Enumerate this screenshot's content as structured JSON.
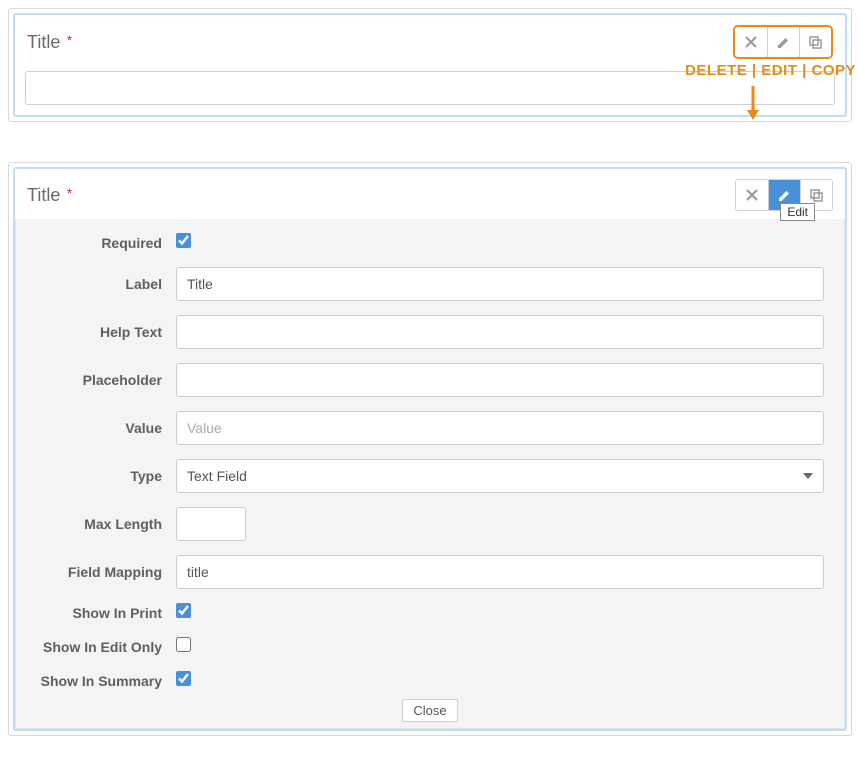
{
  "annotation": {
    "label": "DELETE | EDIT | COPY",
    "tooltip": "Edit"
  },
  "panel1": {
    "title": "Title",
    "required_mark": "*"
  },
  "panel2": {
    "title": "Title",
    "required_mark": "*"
  },
  "form": {
    "required_label": "Required",
    "required_checked": true,
    "label_label": "Label",
    "label_value": "Title",
    "helptext_label": "Help Text",
    "helptext_value": "",
    "placeholder_label": "Placeholder",
    "placeholder_value": "",
    "value_label": "Value",
    "value_placeholder": "Value",
    "type_label": "Type",
    "type_value": "Text Field",
    "maxlength_label": "Max Length",
    "maxlength_value": "",
    "fieldmapping_label": "Field Mapping",
    "fieldmapping_value": "title",
    "showinprint_label": "Show In Print",
    "showinprint_checked": true,
    "showineditonly_label": "Show In Edit Only",
    "showineditonly_checked": false,
    "showinsummary_label": "Show In Summary",
    "showinsummary_checked": true,
    "close_label": "Close"
  }
}
